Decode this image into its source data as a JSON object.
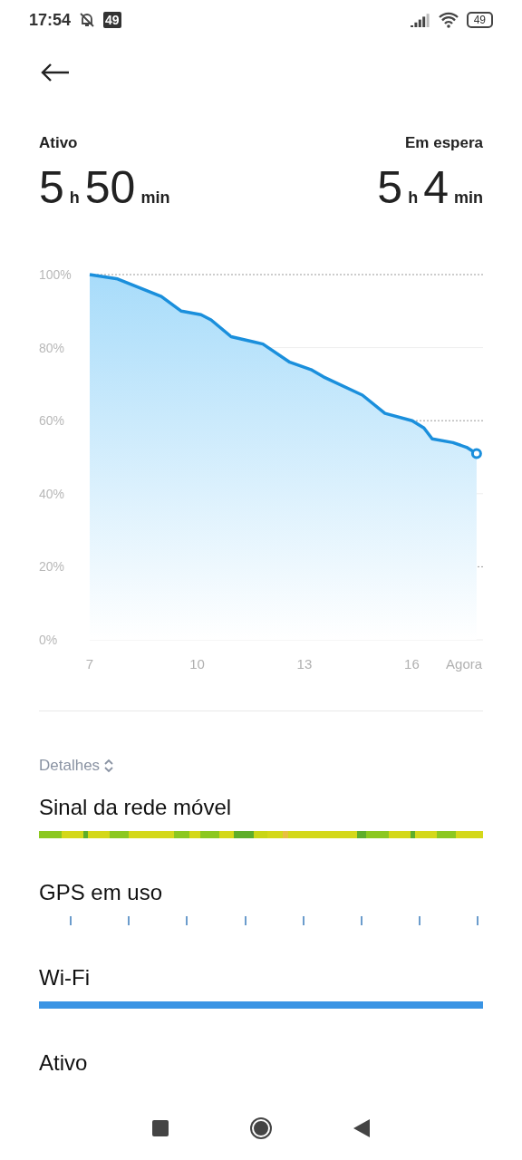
{
  "status_bar": {
    "time": "17:54",
    "notification_badge": "49",
    "battery": "49"
  },
  "summary": [
    {
      "label": "Ativo",
      "hours": "5",
      "hours_unit": "h",
      "minutes": "50",
      "minutes_unit": "min"
    },
    {
      "label": "Em espera",
      "hours": "5",
      "hours_unit": "h",
      "minutes": "4",
      "minutes_unit": "min"
    }
  ],
  "chart_data": {
    "type": "area",
    "x": [
      7,
      7.78,
      9.0,
      9.56,
      10.11,
      10.39,
      10.95,
      11.58,
      11.84,
      12.59,
      13.18,
      13.53,
      14.62,
      15.25,
      16.01,
      16.34,
      16.57,
      17.15,
      17.53,
      17.81
    ],
    "grid": true,
    "series": [
      {
        "color": "#1a8fdc",
        "values": [
          100,
          98.8,
          94,
          90,
          89,
          87.6,
          83,
          81.6,
          81,
          76,
          74,
          72,
          67,
          62,
          60,
          58,
          55,
          54,
          52.7,
          51
        ]
      }
    ],
    "xlim": [
      7,
      17.99
    ],
    "ylim": [
      0,
      100
    ],
    "xticks": [
      7,
      10,
      13,
      16,
      {
        "value": 17.46,
        "label": "Agora"
      }
    ],
    "yticks": [
      {
        "value": 0,
        "label": "0%"
      },
      {
        "value": 20,
        "label": "20%"
      },
      {
        "value": 40,
        "label": "40%"
      },
      {
        "value": 60,
        "label": "60%"
      },
      {
        "value": 80,
        "label": "80%"
      },
      {
        "value": 100,
        "label": "100%"
      }
    ]
  },
  "details": {
    "label": "Detalhes"
  },
  "usage_rows": [
    {
      "kind": "signal",
      "label": "Sinal da rede móvel"
    },
    {
      "kind": "ticks",
      "label": "GPS em uso"
    },
    {
      "kind": "bar",
      "label": "Wi-Fi"
    },
    {
      "kind": "none",
      "label": "Ativo"
    }
  ]
}
